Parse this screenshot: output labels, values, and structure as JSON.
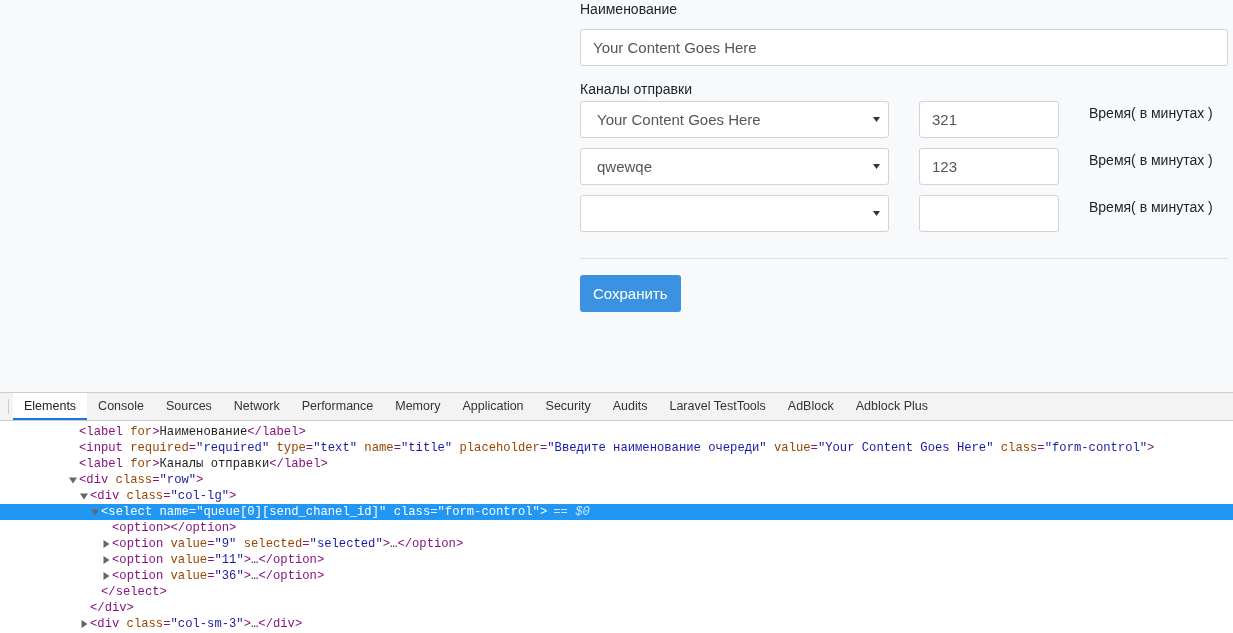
{
  "form": {
    "title_label": "Наименование",
    "title_value": "Your Content Goes Here",
    "channels_label": "Каналы отправки",
    "channels": [
      {
        "channel": "Your Content Goes Here",
        "minutes": "321",
        "minutes_label": "Время( в минутах )"
      },
      {
        "channel": "qwewqe",
        "minutes": "123",
        "minutes_label": "Время( в минутах )"
      },
      {
        "minutes_label": "Время( в минутах )"
      }
    ],
    "save_button": "Сохранить"
  },
  "devtools": {
    "tabs": [
      {
        "label": "Elements",
        "selected": true
      },
      {
        "label": "Console",
        "selected": false
      },
      {
        "label": "Sources",
        "selected": false
      },
      {
        "label": "Network",
        "selected": false
      },
      {
        "label": "Performance",
        "selected": false
      },
      {
        "label": "Memory",
        "selected": false
      },
      {
        "label": "Application",
        "selected": false
      },
      {
        "label": "Security",
        "selected": false
      },
      {
        "label": "Audits",
        "selected": false
      },
      {
        "label": "Laravel TestTools",
        "selected": false
      },
      {
        "label": "AdBlock",
        "selected": false
      },
      {
        "label": "Adblock Plus",
        "selected": false
      }
    ],
    "dom_tree": [
      {
        "kind": "leaf",
        "text": "<label for>Наименование</label>",
        "selected": false
      },
      {
        "kind": "leaf",
        "text": "<input required=\"required\" type=\"text\" name=\"title\" placeholder=\"Введите наименование очереди\" value=\"Your Content Goes Here\" class=\"form-control\">",
        "selected": false
      },
      {
        "kind": "leaf",
        "text": "<label for>Каналы отправки</label>",
        "selected": false
      },
      {
        "kind": "branch",
        "expanded": true,
        "text": "<div class=\"row\">",
        "selected": false,
        "children": [
          {
            "kind": "branch",
            "expanded": true,
            "text": "<div class=\"col-lg\">",
            "selected": false,
            "close": "</div>",
            "children": [
              {
                "kind": "branch",
                "expanded": true,
                "text": "<select name=\"queue[0][send_chanel_id]\" class=\"form-control\">",
                "selected": true,
                "suffix": "== $0",
                "close": "</select>",
                "children": [
                  {
                    "kind": "leaf",
                    "text": "<option></option>",
                    "selected": false
                  },
                  {
                    "kind": "branch",
                    "expanded": false,
                    "text": "<option value=\"9\" selected=\"selected\">…</option>",
                    "selected": false
                  },
                  {
                    "kind": "branch",
                    "expanded": false,
                    "text": "<option value=\"11\">…</option>",
                    "selected": false
                  },
                  {
                    "kind": "branch",
                    "expanded": false,
                    "text": "<option value=\"36\">…</option>",
                    "selected": false
                  }
                ]
              }
            ]
          },
          {
            "kind": "branch",
            "expanded": false,
            "text": "<div class=\"col-sm-3\">…</div>",
            "selected": false
          }
        ]
      }
    ]
  }
}
